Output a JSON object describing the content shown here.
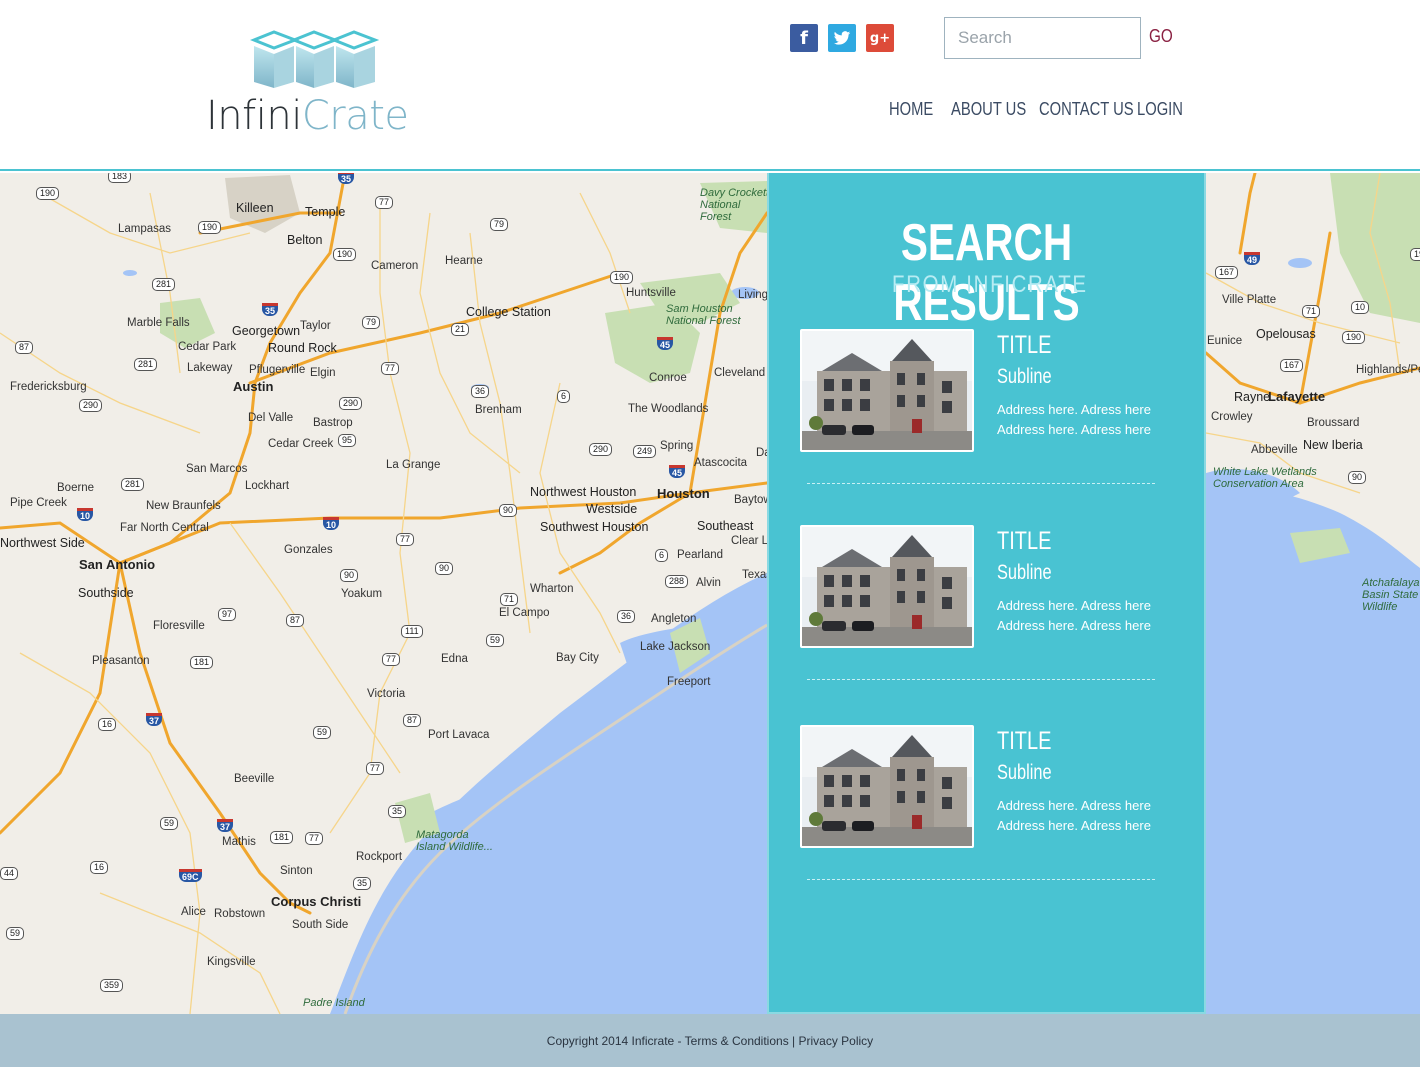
{
  "header": {
    "logo": {
      "part1": "Infini",
      "part2": "Crate"
    },
    "social": [
      {
        "name": "facebook",
        "glyph": "f"
      },
      {
        "name": "twitter",
        "glyph": "t"
      },
      {
        "name": "google-plus",
        "glyph": "g+"
      }
    ],
    "search": {
      "placeholder": "Search",
      "value": ""
    },
    "go_label": "GO",
    "nav": [
      {
        "label": "HOME"
      },
      {
        "label": "ABOUT US"
      },
      {
        "label": "CONTACT US"
      },
      {
        "label": "LOGIN"
      }
    ]
  },
  "map": {
    "cities_big": [
      "Austin",
      "Houston",
      "San Antonio",
      "Corpus Christi",
      "Lafayette"
    ],
    "cities_mid": [
      "Killeen",
      "Temple",
      "Belton",
      "College Station",
      "Georgetown",
      "Round Rock",
      "Northwest Houston",
      "Westside",
      "Southeast",
      "Southwest Houston",
      "Southside",
      "Northwest Side",
      "Rayne",
      "Opelousas",
      "New Iberia"
    ],
    "cities": [
      "Lampasas",
      "Cameron",
      "Hearne",
      "Huntsville",
      "Marble Falls",
      "Taylor",
      "Cedar Park",
      "Pflugerville",
      "Elgin",
      "Lakeway",
      "Fredericksburg",
      "Del Valle",
      "Bastrop",
      "Brenham",
      "Conroe",
      "The Woodlands",
      "Cleveland",
      "Spring",
      "Atascocita",
      "Cedar Creek",
      "San Marcos",
      "La Grange",
      "Lockhart",
      "Boerne",
      "New Braunfels",
      "Pipe Creek",
      "Far North Central",
      "Gonzales",
      "Pearland",
      "Clear Lake",
      "Alvin",
      "Wharton",
      "El Campo",
      "Angleton",
      "Yoakum",
      "Floresville",
      "Pleasanton",
      "Edna",
      "Bay City",
      "Lake Jackson",
      "Freeport",
      "Victoria",
      "Port Lavaca",
      "Beeville",
      "Mathis",
      "Rockport",
      "Sinton",
      "Alice",
      "Robstown",
      "South Side",
      "Kingsville",
      "Livingston",
      "Ville Platte",
      "Eunice",
      "Crowley",
      "Abbeville",
      "Broussard",
      "Highlands/Pe",
      "Baytown",
      "Texas City",
      "Daisetta"
    ],
    "parks": [
      "Davy Crockett National Forest",
      "Sam Houston National Forest",
      "Matagorda Island Wildlife...",
      "Padre Island",
      "White Lake Wetlands Conservation Area",
      "Atchafalaya Basin State Wildlife"
    ],
    "shields": [
      "183",
      "190",
      "35",
      "77",
      "79",
      "190",
      "190",
      "281",
      "35",
      "190",
      "79",
      "21",
      "45",
      "87",
      "281",
      "77",
      "290",
      "36",
      "6",
      "290",
      "95",
      "290",
      "249",
      "45",
      "281",
      "10",
      "90",
      "10",
      "77",
      "6",
      "288",
      "90",
      "90",
      "97",
      "87",
      "71",
      "36",
      "111",
      "59",
      "181",
      "77",
      "16",
      "37",
      "59",
      "87",
      "77",
      "59",
      "37",
      "181",
      "77",
      "35",
      "16",
      "69C",
      "35",
      "359",
      "59",
      "44",
      "167",
      "49",
      "71",
      "10",
      "190",
      "167",
      "90",
      "190"
    ]
  },
  "results": {
    "title": "SEARCH RESULTS",
    "subtitle": "FROM INFICRATE",
    "items": [
      {
        "title": "TITLE",
        "subline": "Subline",
        "address1": "Address here. Adress here",
        "address2": "Address here. Adress here"
      },
      {
        "title": "TITLE",
        "subline": "Subline",
        "address1": "Address here. Adress here",
        "address2": "Address here. Adress here"
      },
      {
        "title": "TITLE",
        "subline": "Subline",
        "address1": "Address here. Adress here",
        "address2": "Address here. Adress here"
      }
    ]
  },
  "footer": {
    "copyright": "Copyright 2014 Inficrate - ",
    "terms": "Terms & Conditions",
    "separator": " | ",
    "privacy": "Privacy Policy"
  },
  "colors": {
    "accent": "#49c3d2",
    "footer": "#a9c2d0",
    "nav_text": "#3b4b63",
    "go": "#8a2142",
    "water": "#a4c4f6",
    "highway": "#f0a62d"
  }
}
